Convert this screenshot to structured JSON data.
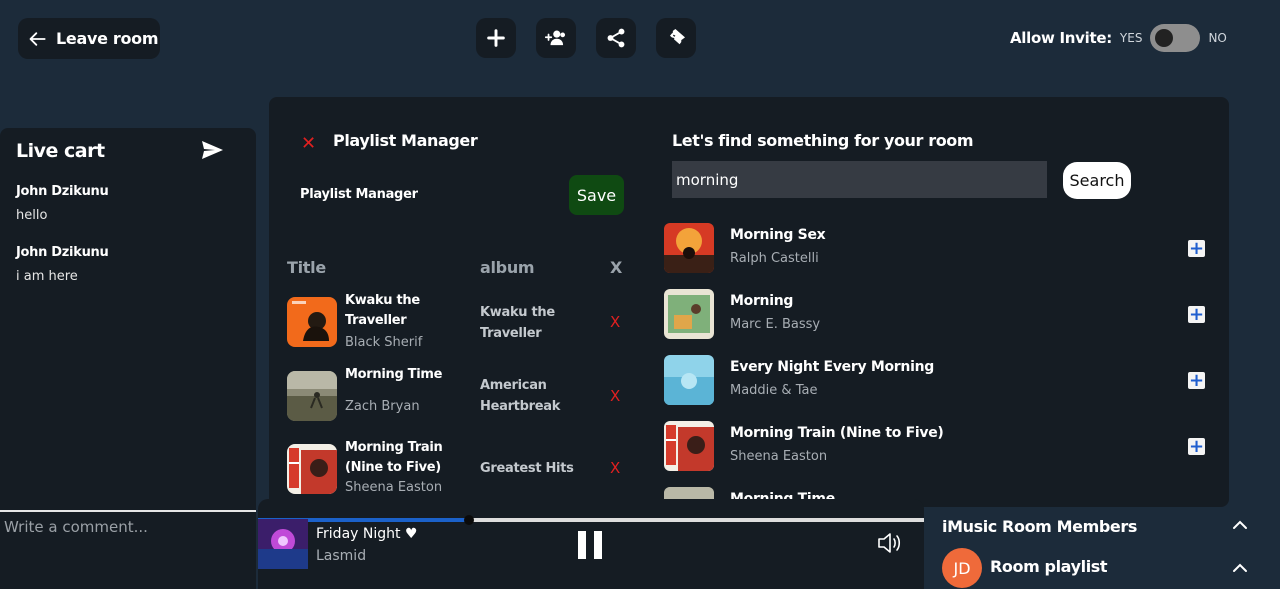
{
  "header": {
    "leave_label": "Leave room",
    "invite_label": "Allow Invite:",
    "invite_yes": "YES",
    "invite_no": "NO",
    "invite_state": "NO"
  },
  "live_cart": {
    "title": "Live cart",
    "messages": [
      {
        "name": "John Dzikunu",
        "text": "hello"
      },
      {
        "name": "John Dzikunu",
        "text": "i am here"
      }
    ],
    "comment_placeholder": "Write a comment..."
  },
  "playlist_manager": {
    "close": "✕",
    "title": "Playlist Manager",
    "subtitle": "Playlist Manager",
    "save_label": "Save",
    "columns": [
      "Title",
      "album",
      "X"
    ],
    "rows": [
      {
        "title": "Kwaku the Traveller",
        "artist": "Black Sherif",
        "album": "Kwaku the Traveller",
        "remove": "X"
      },
      {
        "title": "Morning Time",
        "artist": "Zach Bryan",
        "album": "American Heartbreak",
        "remove": "X"
      },
      {
        "title": "Morning Train (Nine to Five)",
        "artist": "Sheena Easton",
        "album": "Greatest Hits",
        "remove": "X"
      }
    ]
  },
  "search": {
    "title": "Let's find something for your room",
    "value": "morning",
    "button_label": "Search",
    "results": [
      {
        "title": "Morning Sex",
        "artist": "Ralph Castelli"
      },
      {
        "title": "Morning",
        "artist": "Marc E. Bassy"
      },
      {
        "title": "Every Night Every Morning",
        "artist": "Maddie & Tae"
      },
      {
        "title": "Morning Train (Nine to Five)",
        "artist": "Sheena Easton"
      },
      {
        "title": "Morning Time",
        "artist": ""
      }
    ]
  },
  "player": {
    "title": "Friday Night",
    "heart": "♥",
    "artist": "Lasmid",
    "progress": 0.317
  },
  "members": {
    "title": "iMusic Room Members",
    "avatar_initials": "JD",
    "room_playlist": "Room playlist"
  },
  "colors": {
    "background": "#1c2b3a",
    "panel": "#151c23",
    "save": "#0f4a12",
    "remove": "#e02020",
    "progress": "#1b61c9",
    "avatar": "#ef6a3a"
  }
}
